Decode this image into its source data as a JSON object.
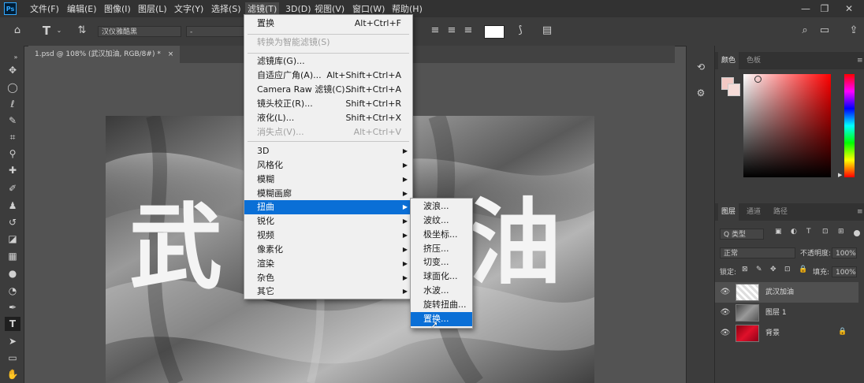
{
  "menubar": {
    "items": [
      "文件(F)",
      "编辑(E)",
      "图像(I)",
      "图层(L)",
      "文字(Y)",
      "选择(S)",
      "滤镜(T)",
      "3D(D)",
      "视图(V)",
      "窗口(W)",
      "帮助(H)"
    ],
    "window_controls": [
      "—",
      "❐",
      "✕"
    ]
  },
  "options_bar": {
    "font_family": "汉仪雅酷黑",
    "font_style": "-"
  },
  "document": {
    "tab_title": "1.psd @ 108% (武汉加油, RGB/8#) *",
    "tab_close": "×",
    "char_left": "武",
    "char_right": "油"
  },
  "filter_menu": {
    "items": [
      {
        "label": "置换",
        "shortcut": "Alt+Ctrl+F",
        "disabled": false
      },
      {
        "label": "转换为智能滤镜(S)",
        "shortcut": "",
        "disabled": true
      },
      {
        "label": "滤镜库(G)...",
        "shortcut": "",
        "disabled": false
      },
      {
        "label": "自适应广角(A)...",
        "shortcut": "Alt+Shift+Ctrl+A",
        "disabled": false
      },
      {
        "label": "Camera Raw 滤镜(C)...",
        "shortcut": "Shift+Ctrl+A",
        "disabled": false
      },
      {
        "label": "镜头校正(R)...",
        "shortcut": "Shift+Ctrl+R",
        "disabled": false
      },
      {
        "label": "液化(L)...",
        "shortcut": "Shift+Ctrl+X",
        "disabled": false
      },
      {
        "label": "消失点(V)...",
        "shortcut": "Alt+Ctrl+V",
        "disabled": true
      },
      {
        "label": "3D",
        "submenu": true
      },
      {
        "label": "风格化",
        "submenu": true
      },
      {
        "label": "模糊",
        "submenu": true
      },
      {
        "label": "模糊画廊",
        "submenu": true
      },
      {
        "label": "扭曲",
        "submenu": true,
        "highlighted": true
      },
      {
        "label": "锐化",
        "submenu": true
      },
      {
        "label": "视频",
        "submenu": true
      },
      {
        "label": "像素化",
        "submenu": true
      },
      {
        "label": "渲染",
        "submenu": true
      },
      {
        "label": "杂色",
        "submenu": true
      },
      {
        "label": "其它",
        "submenu": true
      }
    ]
  },
  "distort_submenu": {
    "items": [
      "波浪...",
      "波纹...",
      "极坐标...",
      "挤压...",
      "切变...",
      "球面化...",
      "水波...",
      "旋转扭曲...",
      "置换..."
    ],
    "highlighted": "置换..."
  },
  "color_panel": {
    "tabs": [
      "颜色",
      "色板"
    ]
  },
  "layers_panel": {
    "tabs": [
      "图层",
      "通道",
      "路径"
    ],
    "filter_label": "Q 类型",
    "blend_mode": "正常",
    "opacity_label": "不透明度:",
    "opacity_value": "100%",
    "lock_label": "锁定:",
    "fill_label": "填充:",
    "fill_value": "100%",
    "layers": [
      {
        "name": "武汉加油",
        "selected": true
      },
      {
        "name": "图层 1",
        "selected": false
      },
      {
        "name": "背景",
        "selected": false,
        "locked": true
      }
    ]
  },
  "colors": {
    "accent": "#0a6fd6",
    "foreground_swatch": "#f2c9c4",
    "background_swatch": "#f6dcd8"
  }
}
